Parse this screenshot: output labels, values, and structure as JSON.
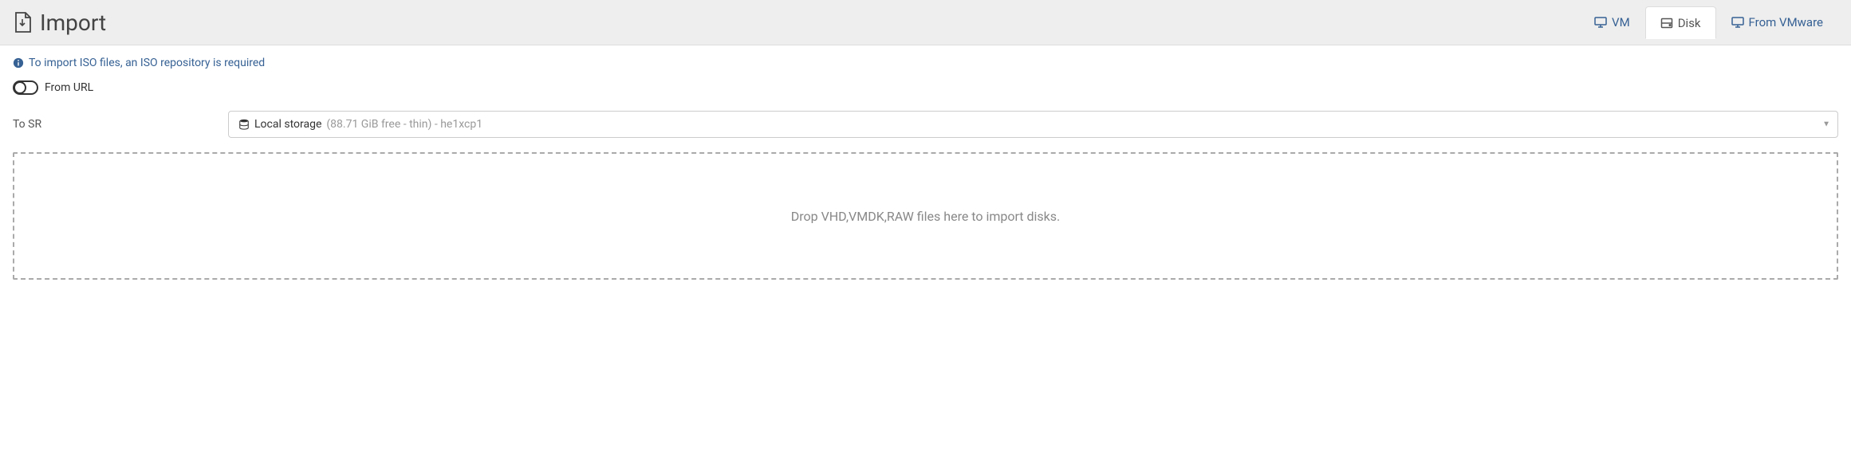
{
  "header": {
    "title": "Import"
  },
  "tabs": {
    "vm": "VM",
    "disk": "Disk",
    "vmware": "From VMware"
  },
  "info": {
    "text": "To import ISO files, an ISO repository is required"
  },
  "toggle": {
    "label": "From URL"
  },
  "form": {
    "sr_label": "To SR",
    "sr_value_main": "Local storage",
    "sr_value_sub": " (88.71 GiB free - thin) - he1xcp1"
  },
  "dropzone": {
    "text": "Drop VHD,VMDK,RAW files here to import disks."
  }
}
